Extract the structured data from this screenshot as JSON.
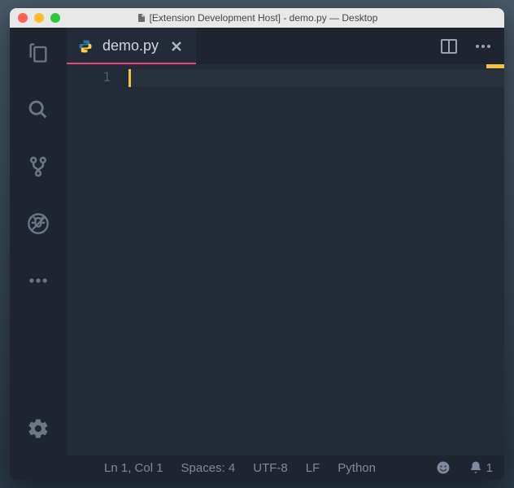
{
  "window": {
    "title": "[Extension Development Host] - demo.py — Desktop"
  },
  "tab": {
    "filename": "demo.py"
  },
  "editor": {
    "line_numbers": [
      "1"
    ]
  },
  "status": {
    "cursor": "Ln 1, Col 1",
    "indent": "Spaces: 4",
    "encoding": "UTF-8",
    "eol": "LF",
    "language": "Python",
    "notifications": "1"
  }
}
